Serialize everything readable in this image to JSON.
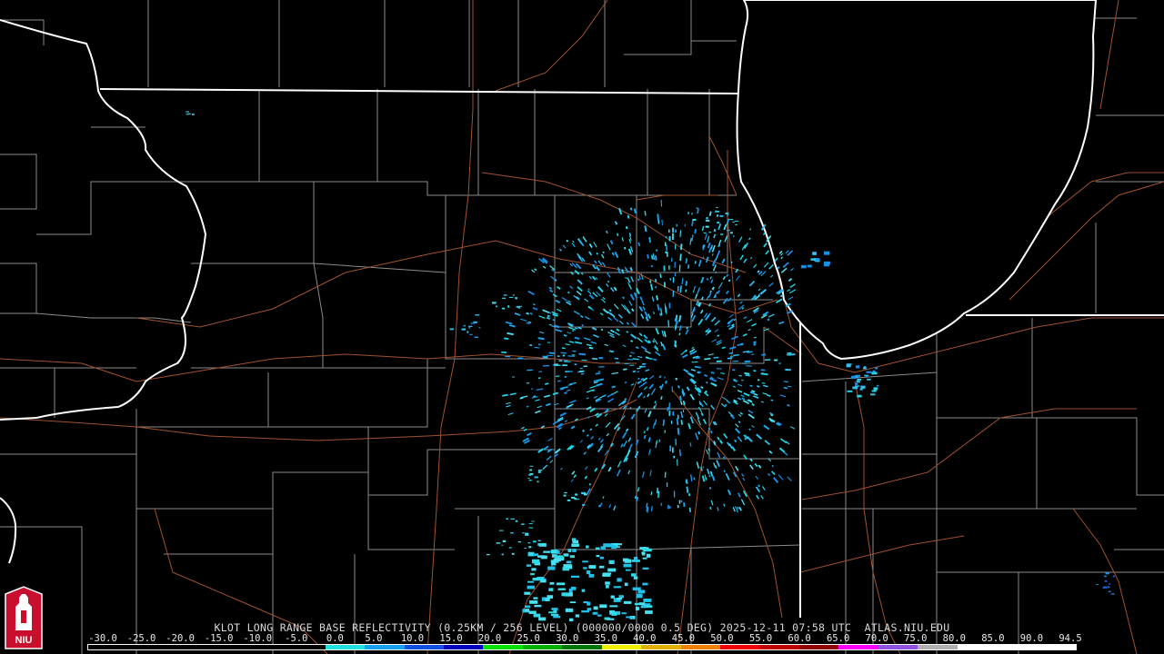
{
  "map": {
    "caption": "KLOT LONG RANGE BASE REFLECTIVITY (0.25KM / 256 LEVEL) (000000/0000 0.5 DEG) 2025-12-11 07:58 UTC  ATLAS.NIU.EDU",
    "radar_site": "KLOT",
    "product": "LONG RANGE BASE REFLECTIVITY",
    "colors": {
      "background": "#000000",
      "state_border": "#ffffff",
      "county_border": "#8a8a8a",
      "road": "#a0522d",
      "lake": "#000000"
    },
    "layers": [
      "state-borders",
      "county-borders",
      "highways",
      "lake-michigan-shoreline",
      "radar-returns"
    ]
  },
  "legend": {
    "labels": [
      "-30.0",
      "-25.0",
      "-20.0",
      "-15.0",
      "-10.0",
      "-5.0",
      "0.0",
      "5.0",
      "10.0",
      "15.0",
      "20.0",
      "25.0",
      "30.0",
      "35.0",
      "40.0",
      "45.0",
      "50.0",
      "55.0",
      "60.0",
      "65.0",
      "70.0",
      "75.0",
      "80.0",
      "85.0",
      "90.0",
      "94.5"
    ],
    "colors": [
      "#000000",
      "#000000",
      "#000000",
      "#000000",
      "#000000",
      "#000000",
      "#20e0e0",
      "#18a0f0",
      "#1050e0",
      "#0000c0",
      "#00e000",
      "#00b000",
      "#007800",
      "#f0f000",
      "#e0b000",
      "#f08000",
      "#f00000",
      "#c00000",
      "#900000",
      "#ff00ff",
      "#9050e0",
      "#b0b0b0",
      "#ffffff",
      "#ffffff",
      "#ffffff"
    ]
  },
  "logo": {
    "text": "NIU",
    "colors": {
      "bg": "#c8102e",
      "fg": "#ffffff"
    }
  }
}
